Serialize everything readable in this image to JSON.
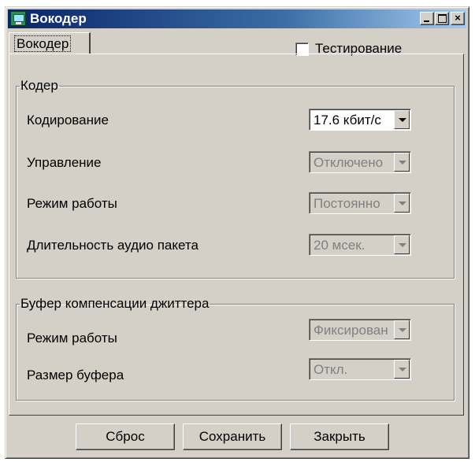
{
  "window": {
    "title": "Вокодер",
    "icon": "vocoder-app-icon",
    "controls": {
      "minimize": "minimize-icon",
      "maximize": "maximize-icon",
      "close": "×"
    }
  },
  "tabs": [
    {
      "label": "Вокодер",
      "selected": true
    }
  ],
  "testing": {
    "label": "Тестирование",
    "checked": false
  },
  "coder": {
    "title": "Кодер",
    "rows": [
      {
        "label": "Кодирование",
        "value": "17.6 кбит/с",
        "enabled": true
      },
      {
        "label": "Управление",
        "value": "Отключено",
        "enabled": false
      },
      {
        "label": "Режим работы",
        "value": "Постоянно",
        "enabled": false
      },
      {
        "label": "Длительность аудио пакета",
        "value": "20 мсек.",
        "enabled": false
      }
    ]
  },
  "jitter": {
    "title": "Буфер компенсации джиттера",
    "rows": [
      {
        "label": "Режим работы",
        "value": "Фиксирован",
        "enabled": false
      },
      {
        "label": "Размер буфера",
        "value": "Откл.",
        "enabled": false
      }
    ]
  },
  "buttons": {
    "reset": "Сброс",
    "save": "Сохранить",
    "close": "Закрыть"
  }
}
